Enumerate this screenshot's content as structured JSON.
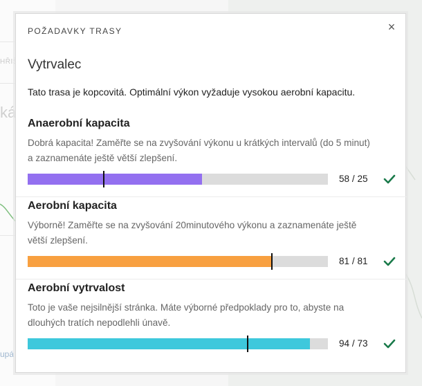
{
  "background": {
    "left_snippet_1": "HŘIŠ",
    "left_snippet_2": "ká",
    "left_snippet_3": "upá"
  },
  "modal": {
    "header": "POŽADAVKY TRASY",
    "close_glyph": "×",
    "profile_title": "Vytrvalec",
    "profile_description": "Tato trasa je kopcovitá. Optimální výkon vyžaduje vysokou aerobní kapacitu."
  },
  "requirements": [
    {
      "title": "Anaerobní kapacita",
      "text": "Dobrá kapacita! Zaměřte se na zvyšování výkonu u krátkých intervalů (do 5 minut) a zaznamenáte ještě větší zlepšení.",
      "value_label": "58 / 25",
      "fill_fraction": 0.58,
      "marker_fraction": 0.25,
      "color": "#9370f0",
      "status": "check-icon"
    },
    {
      "title": "Aerobní kapacita",
      "text": "Výborně! Zaměřte se na zvyšování 20minutového výkonu a zaznamenáte ještě větší zlepšení.",
      "value_label": "81 / 81",
      "fill_fraction": 0.81,
      "marker_fraction": 0.81,
      "color": "#f8a040",
      "status": "check-icon"
    },
    {
      "title": "Aerobní vytrvalost",
      "text": "Toto je vaše nejsilnější stránka. Máte výborné předpoklady pro to, abyste na dlouhých tratích nepodlehli únavě.",
      "value_label": "94 / 73",
      "fill_fraction": 0.94,
      "marker_fraction": 0.73,
      "color": "#3ec8dc",
      "status": "check-icon"
    }
  ],
  "colors": {
    "check": "#1a7a4a",
    "track": "#dcdcdc"
  }
}
